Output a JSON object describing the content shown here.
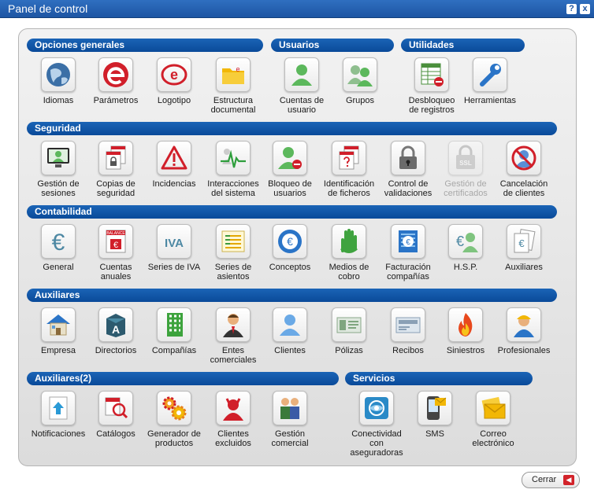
{
  "window": {
    "title": "Panel de control",
    "help_label": "?",
    "close_label": "x"
  },
  "sections": {
    "opciones": "Opciones generales",
    "usuarios": "Usuarios",
    "utilidades": "Utilidades",
    "seguridad": "Seguridad",
    "contabilidad": "Contabilidad",
    "auxiliares": "Auxiliares",
    "auxiliares2": "Auxiliares(2)",
    "servicios": "Servicios"
  },
  "items": {
    "idiomas": "Idiomas",
    "parametros": "Parámetros",
    "logotipo": "Logotipo",
    "estructura": "Estructura\ndocumental",
    "cuentas_usuario": "Cuentas de\nusuario",
    "grupos": "Grupos",
    "desbloqueo": "Desbloqueo\nde registros",
    "herramientas": "Herramientas",
    "gestion_sesiones": "Gestión de\nsesiones",
    "copias": "Copias de\nseguridad",
    "incidencias": "Incidencias",
    "interacciones": "Interacciones\ndel sistema",
    "bloqueo": "Bloqueo de\nusuarios",
    "identificacion": "Identificación\nde ficheros",
    "control": "Control de\nvalidaciones",
    "certificados": "Gestión de\ncertificados",
    "cancelacion": "Cancelación\nde clientes",
    "general": "General",
    "cuentas_anuales": "Cuentas\nanuales",
    "series_iva": "Series de IVA",
    "series_asientos": "Series de\nasientos",
    "conceptos": "Conceptos",
    "medios": "Medios de\ncobro",
    "facturacion": "Facturación\ncompañías",
    "hsp": "H.S.P.",
    "auxiliares_c": "Auxiliares",
    "empresa": "Empresa",
    "directorios": "Directorios",
    "companias": "Compañías",
    "entes": "Entes\ncomerciales",
    "clientes": "Clientes",
    "polizas": "Pólizas",
    "recibos": "Recibos",
    "siniestros": "Siniestros",
    "profesionales": "Profesionales",
    "notificaciones": "Notificaciones",
    "catalogos": "Catálogos",
    "generador": "Generador de\nproductos",
    "excluidos": "Clientes\nexcluidos",
    "gestion_comercial": "Gestión\ncomercial",
    "conectividad": "Conectividad\ncon\naseguradoras",
    "sms": "SMS",
    "correo": "Correo\nelectrónico"
  },
  "icon_text": {
    "ssl": "SSL",
    "iva": "IVA",
    "ie": "e",
    "a": "A",
    "euro": "€",
    "balance": "BALANCE"
  },
  "footer": {
    "close_label": "Cerrar"
  }
}
